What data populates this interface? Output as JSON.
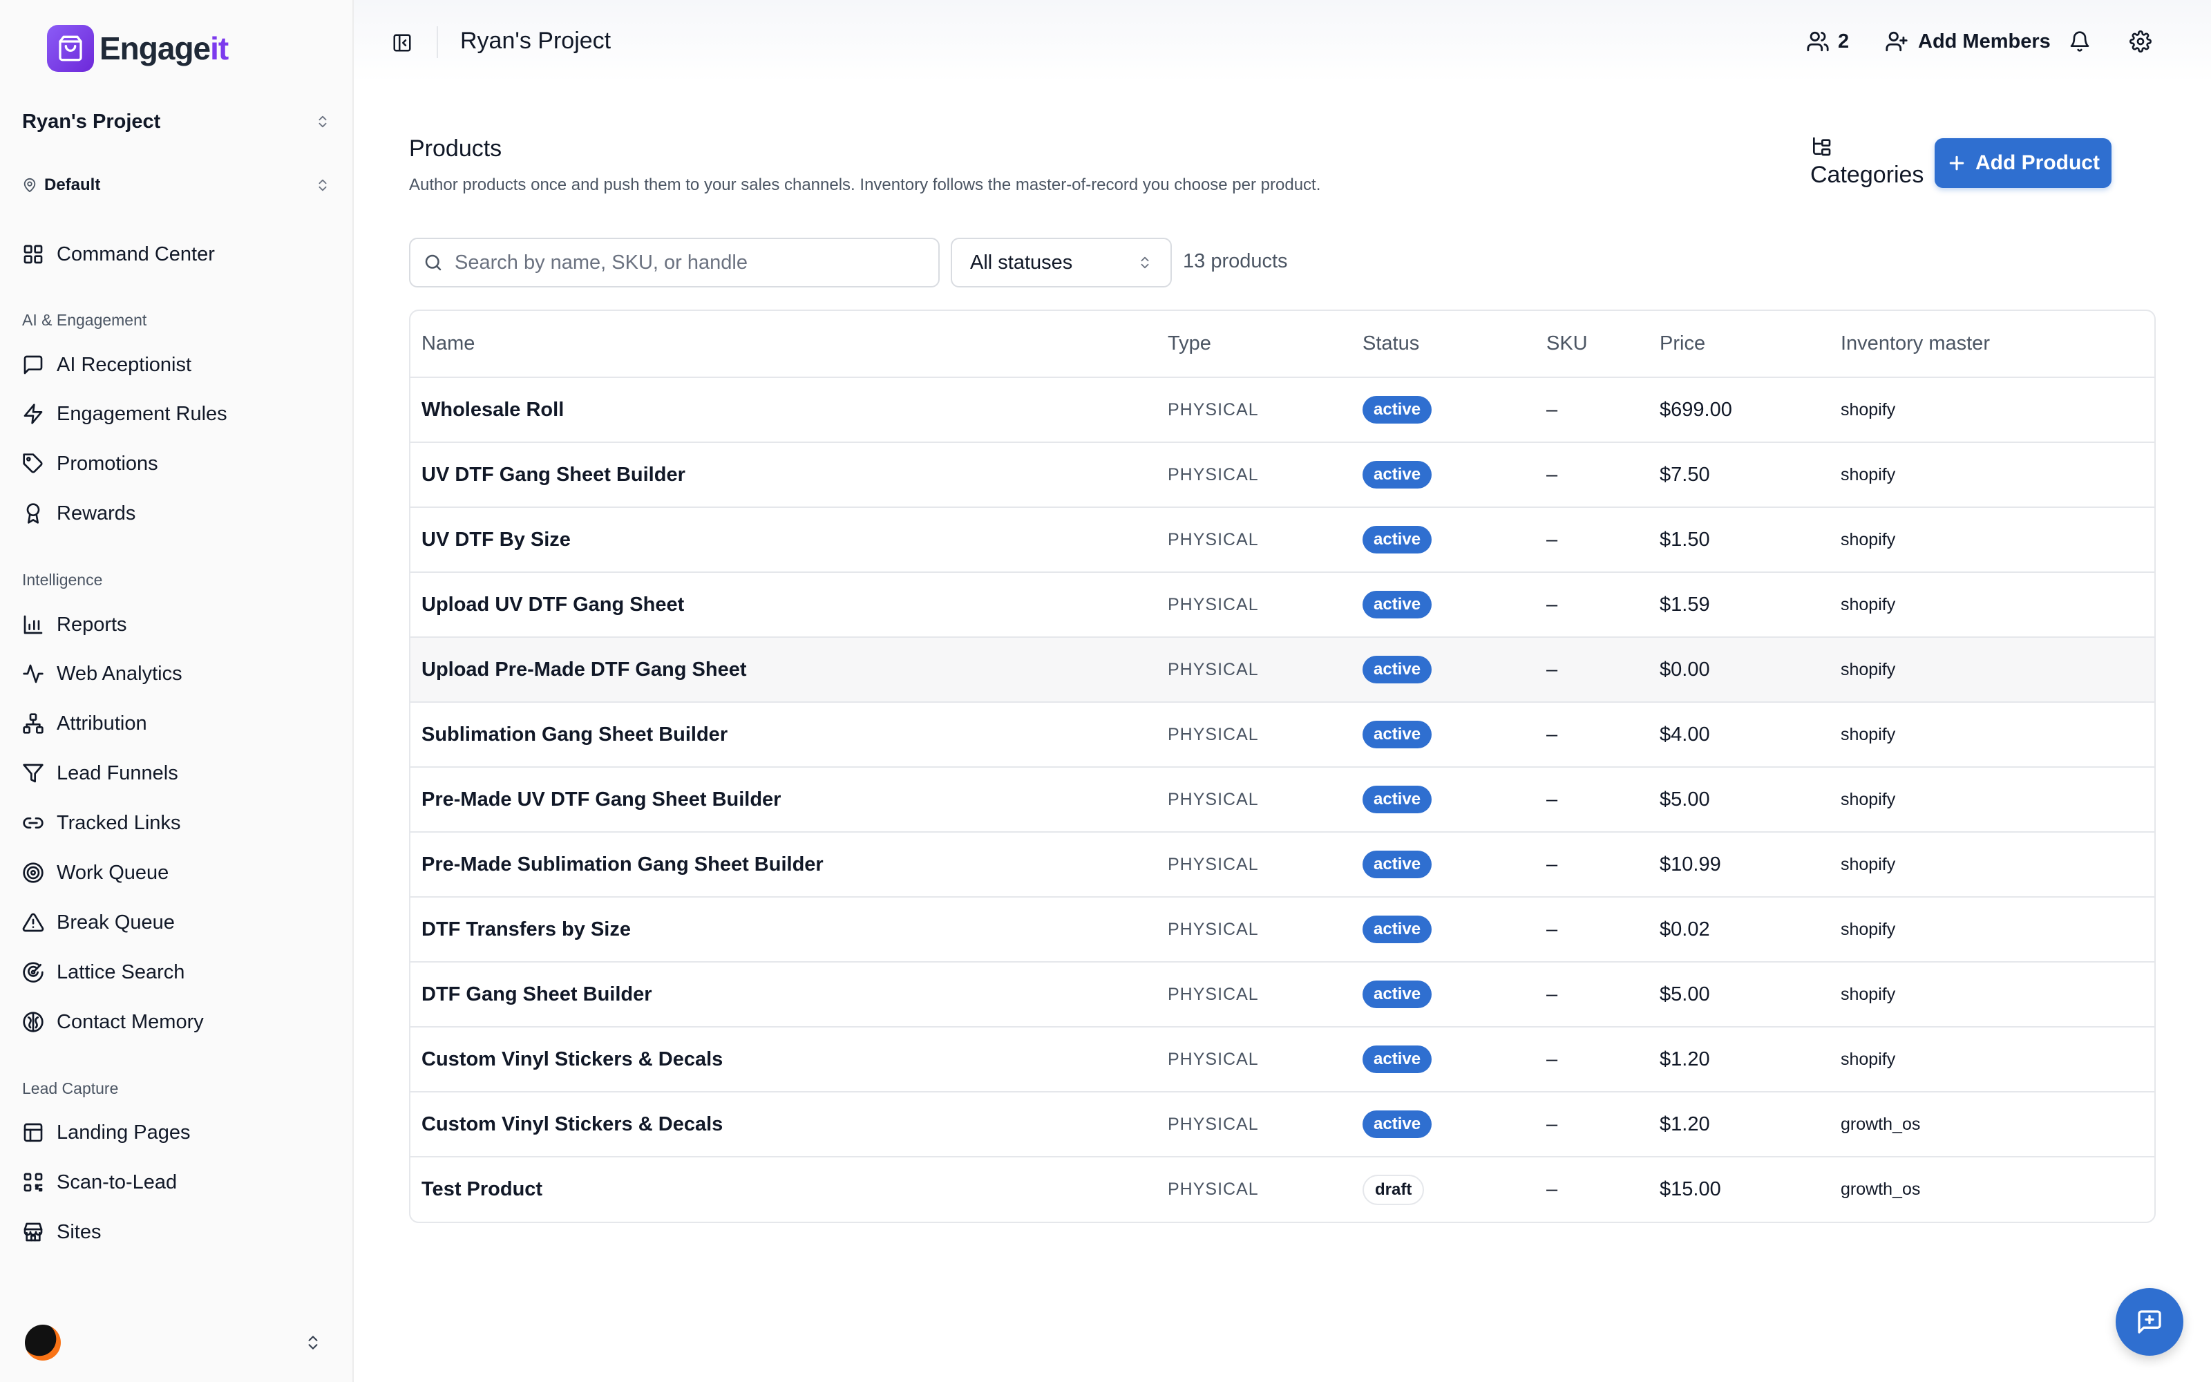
{
  "brand": {
    "name_main": "Engage",
    "name_accent": "it"
  },
  "sidebar": {
    "project": "Ryan's Project",
    "location": "Default",
    "command_center": "Command Center",
    "sections": [
      {
        "title": "AI & Engagement",
        "items": [
          "AI Receptionist",
          "Engagement Rules",
          "Promotions",
          "Rewards"
        ]
      },
      {
        "title": "Intelligence",
        "items": [
          "Reports",
          "Web Analytics",
          "Attribution",
          "Lead Funnels",
          "Tracked Links",
          "Work Queue",
          "Break Queue",
          "Lattice Search",
          "Contact Memory"
        ]
      },
      {
        "title": "Lead Capture",
        "items": [
          "Landing Pages",
          "Scan-to-Lead",
          "Sites"
        ]
      }
    ]
  },
  "topbar": {
    "title": "Ryan's Project",
    "members_count": "2",
    "add_members": "Add Members"
  },
  "page": {
    "title": "Products",
    "subtitle": "Author products once and push them to your sales channels. Inventory follows the master-of-record you choose per product.",
    "categories": "Categories",
    "add_product": "Add Product"
  },
  "filters": {
    "search_placeholder": "Search by name, SKU, or handle",
    "status_value": "All statuses",
    "count_text": "13 products"
  },
  "table": {
    "columns": [
      "Name",
      "Type",
      "Status",
      "SKU",
      "Price",
      "Inventory master"
    ],
    "rows": [
      {
        "name": "Wholesale Roll",
        "type": "PHYSICAL",
        "status": "active",
        "sku": "–",
        "price": "$699.00",
        "inventory": "shopify"
      },
      {
        "name": "UV DTF Gang Sheet Builder",
        "type": "PHYSICAL",
        "status": "active",
        "sku": "–",
        "price": "$7.50",
        "inventory": "shopify"
      },
      {
        "name": "UV DTF By Size",
        "type": "PHYSICAL",
        "status": "active",
        "sku": "–",
        "price": "$1.50",
        "inventory": "shopify"
      },
      {
        "name": "Upload UV DTF Gang Sheet",
        "type": "PHYSICAL",
        "status": "active",
        "sku": "–",
        "price": "$1.59",
        "inventory": "shopify"
      },
      {
        "name": "Upload Pre-Made DTF Gang Sheet",
        "type": "PHYSICAL",
        "status": "active",
        "sku": "–",
        "price": "$0.00",
        "inventory": "shopify"
      },
      {
        "name": "Sublimation Gang Sheet Builder",
        "type": "PHYSICAL",
        "status": "active",
        "sku": "–",
        "price": "$4.00",
        "inventory": "shopify"
      },
      {
        "name": "Pre-Made UV DTF Gang Sheet Builder",
        "type": "PHYSICAL",
        "status": "active",
        "sku": "–",
        "price": "$5.00",
        "inventory": "shopify"
      },
      {
        "name": "Pre-Made Sublimation Gang Sheet Builder",
        "type": "PHYSICAL",
        "status": "active",
        "sku": "–",
        "price": "$10.99",
        "inventory": "shopify"
      },
      {
        "name": "DTF Transfers by Size",
        "type": "PHYSICAL",
        "status": "active",
        "sku": "–",
        "price": "$0.02",
        "inventory": "shopify"
      },
      {
        "name": "DTF Gang Sheet Builder",
        "type": "PHYSICAL",
        "status": "active",
        "sku": "–",
        "price": "$5.00",
        "inventory": "shopify"
      },
      {
        "name": "Custom Vinyl Stickers & Decals",
        "type": "PHYSICAL",
        "status": "active",
        "sku": "–",
        "price": "$1.20",
        "inventory": "shopify"
      },
      {
        "name": "Custom Vinyl Stickers & Decals",
        "type": "PHYSICAL",
        "status": "active",
        "sku": "–",
        "price": "$1.20",
        "inventory": "growth_os"
      },
      {
        "name": "Test Product",
        "type": "PHYSICAL",
        "status": "draft",
        "sku": "–",
        "price": "$15.00",
        "inventory": "growth_os"
      }
    ]
  },
  "colors": {
    "primary": "#2f6fd0",
    "brand_accent": "#7c3aed"
  },
  "icons": {
    "sidebar": [
      "bot-icon",
      "zap-icon",
      "tag-icon",
      "award-icon",
      "bar-chart-icon",
      "activity-icon",
      "network-icon",
      "filter-icon",
      "link-icon",
      "target-icon",
      "alert-triangle-icon",
      "radar-icon",
      "brain-icon",
      "layout-icon",
      "qr-code-icon",
      "store-icon"
    ]
  }
}
